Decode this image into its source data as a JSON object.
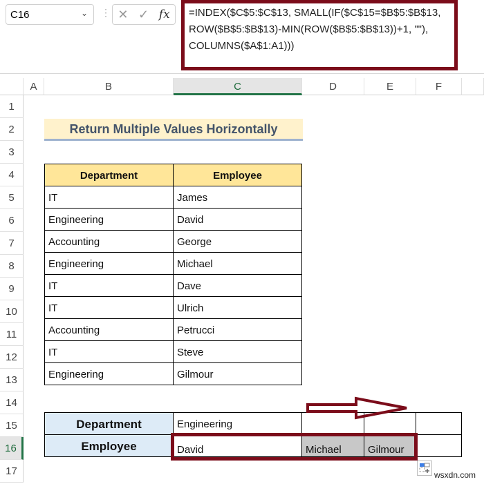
{
  "name_box": "C16",
  "formula": "=INDEX($C$5:$C$13, SMALL(IF($C$15=$B$5:$B$13,\nROW($B$5:$B$13)-MIN(ROW($B$5:$B$13))+1, \"\"),\nCOLUMNS($A$1:A1)))",
  "columns": [
    "A",
    "B",
    "C",
    "D",
    "E",
    "F"
  ],
  "rows": [
    "1",
    "2",
    "3",
    "4",
    "5",
    "6",
    "7",
    "8",
    "9",
    "10",
    "11",
    "12",
    "13",
    "14",
    "15",
    "16",
    "17"
  ],
  "title": "Return Multiple Values Horizontally",
  "table": {
    "headers": [
      "Department",
      "Employee"
    ],
    "rows": [
      [
        "IT",
        "James"
      ],
      [
        "Engineering",
        "David"
      ],
      [
        "Accounting",
        "George"
      ],
      [
        "Engineering",
        "Michael"
      ],
      [
        "IT",
        "Dave"
      ],
      [
        "IT",
        "Ulrich"
      ],
      [
        "Accounting",
        "Petrucci"
      ],
      [
        "IT",
        "Steve"
      ],
      [
        "Engineering",
        "Gilmour"
      ]
    ]
  },
  "lookup": {
    "dept_label": "Department",
    "dept_value": "Engineering",
    "emp_label": "Employee",
    "results": [
      "David",
      "Michael",
      "Gilmour"
    ]
  },
  "watermark": "wsxdn.com",
  "colors": {
    "accent": "#7b0c1a",
    "header_fill": "#ffe699",
    "label_fill": "#ddebf7"
  }
}
